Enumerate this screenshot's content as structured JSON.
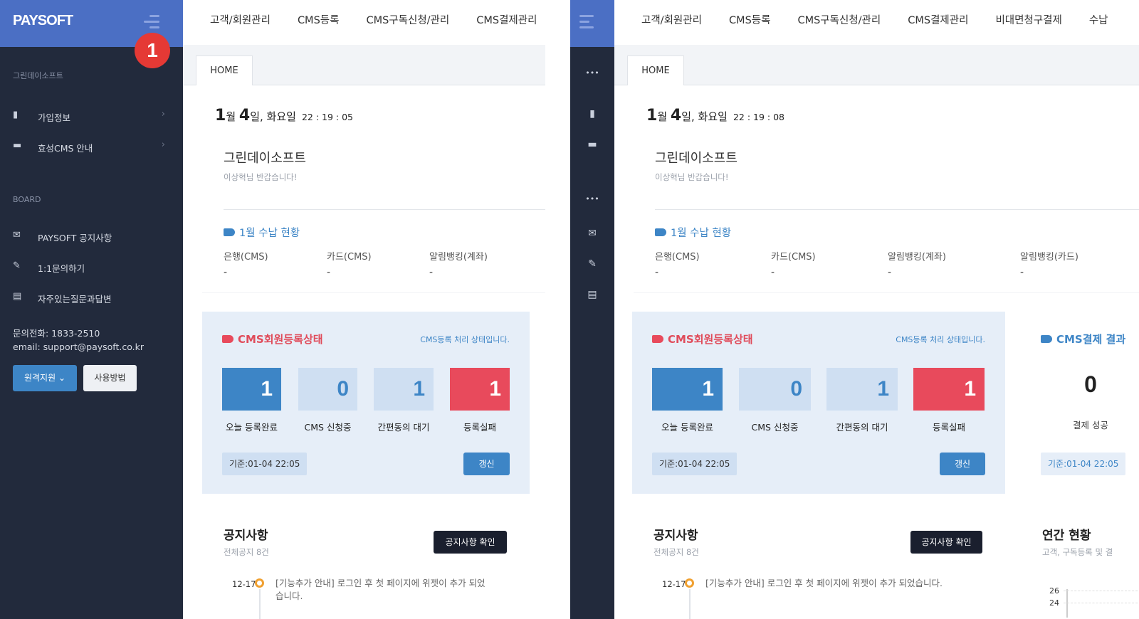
{
  "brand": {
    "logo": "PAYSOFT",
    "step_badge": "1"
  },
  "top_nav": {
    "left": [
      "고객/회원관리",
      "CMS등록",
      "CMS구독신청/관리",
      "CMS결제관리"
    ],
    "right": [
      "고객/회원관리",
      "CMS등록",
      "CMS구독신청/관리",
      "CMS결제관리",
      "비대면청구결제",
      "수납"
    ]
  },
  "sidebar": {
    "company": "그린데이소프트",
    "items": [
      {
        "label": "가입정보",
        "icon": "id-card-icon"
      },
      {
        "label": "효성CMS 안내",
        "icon": "wallet-icon"
      }
    ],
    "board_label": "BOARD",
    "board_items": [
      {
        "label": "PAYSOFT 공지사항",
        "icon": "mail-open-icon"
      },
      {
        "label": "1:1문의하기",
        "icon": "edit-icon"
      },
      {
        "label": "자주있는질문과답변",
        "icon": "document-icon"
      }
    ],
    "phone": "문의전화: 1833-2510",
    "email": "email: support@paysoft.co.kr",
    "remote_button": "원격지원",
    "howto_button": "사용방법",
    "more_dots": "•••"
  },
  "tab": {
    "home": "HOME"
  },
  "datetime": {
    "month_num": "1",
    "month_unit": "월 ",
    "day_num": "4",
    "day_unit": "일, 화요일",
    "clock_left": "22 : 19 : 05",
    "clock_right": "22 : 19 : 08"
  },
  "welcome": {
    "company": "그린데이소프트",
    "greeting": "이상혁님 반갑습니다!"
  },
  "revenue": {
    "title": "1월 수납 현황",
    "cols": [
      {
        "label": "은행(CMS)",
        "value": "-"
      },
      {
        "label": "카드(CMS)",
        "value": "-"
      },
      {
        "label": "알림뱅킹(계좌)",
        "value": "-"
      },
      {
        "label": "알림뱅킹(카드)",
        "value": "-"
      }
    ]
  },
  "cms_status": {
    "title": "CMS회원등록상태",
    "note": "CMS등록 처리 상태입니다.",
    "boxes": [
      {
        "value": "1",
        "label": "오늘 등록완료",
        "bg": "#3d85c6",
        "fg": "#ffffff"
      },
      {
        "value": "0",
        "label": "CMS 신청중",
        "bg": "#cfdff2",
        "fg": "#3d85c6"
      },
      {
        "value": "1",
        "label": "간편동의 대기",
        "bg": "#cfdff2",
        "fg": "#3d85c6"
      },
      {
        "value": "1",
        "label": "등록실패",
        "bg": "#e84a5c",
        "fg": "#ffffff"
      }
    ],
    "standard": "기준:01-04 22:05",
    "refresh": "갱신"
  },
  "cms_payment": {
    "title": "CMS결제 결과",
    "value": "0",
    "label": "결제 성공",
    "standard": "기준:01-04 22:05"
  },
  "notice": {
    "title": "공지사항",
    "sub": "전체공지 8건",
    "button": "공지사항 확인",
    "first_date": "12-17",
    "first_text_l1": "[기능추가 안내] 로그인 후 첫 페이지에 위젯이 추가 되었",
    "first_text_l2": "습니다.",
    "first_text_full": "[기능추가 안내] 로그인 후 첫 페이지에 위젯이 추가 되었습니다."
  },
  "annual": {
    "title": "연간 현황",
    "sub": "고객, 구독등록 및 결",
    "y_ticks": [
      "26",
      "24"
    ]
  },
  "colors": {
    "sidebar": "#222a3c",
    "logo_bar": "#4b6fc4",
    "accent": "#3d85c6",
    "danger": "#e84a5c"
  }
}
